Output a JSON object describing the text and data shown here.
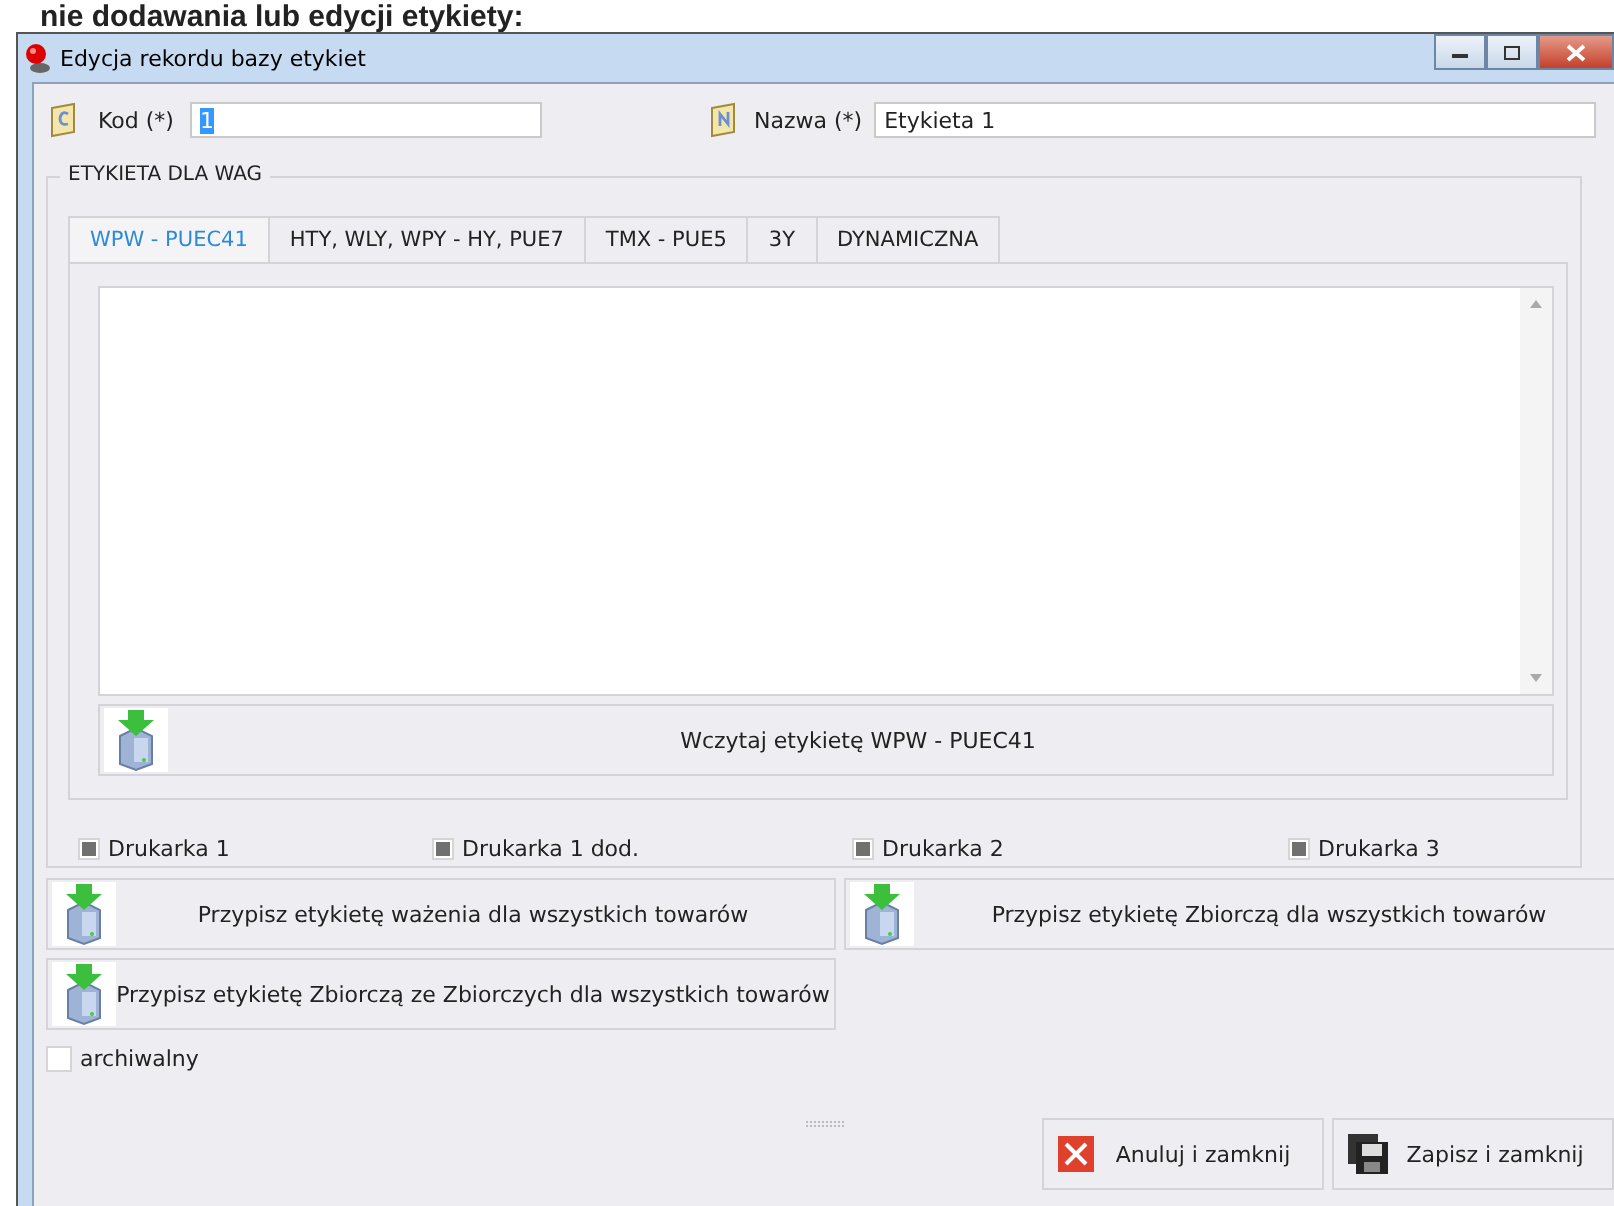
{
  "heading": "nie dodawania lub edycji etykiety:",
  "window": {
    "title": "Edycja rekordu bazy etykiet"
  },
  "fields": [
    {
      "kind": "code",
      "label": "Kod (*)",
      "value": "1"
    },
    {
      "kind": "name",
      "label": "Nazwa (*)",
      "value": "Etykieta 1"
    }
  ],
  "group": {
    "title": "ETYKIETA DLA WAG",
    "tabs": [
      {
        "label": "WPW - PUEC41",
        "selected": true
      },
      {
        "label": "HTY, WLY, WPY - HY, PUE7",
        "selected": false
      },
      {
        "label": "TMX - PUE5",
        "selected": false
      },
      {
        "label": "3Y",
        "selected": false
      },
      {
        "label": "DYNAMICZNA",
        "selected": false
      }
    ],
    "load_button": "Wczytaj etykietę WPW - PUEC41",
    "printers": [
      {
        "label": "Drukarka 1",
        "checked": true
      },
      {
        "label": "Drukarka 1  dod.",
        "checked": true
      },
      {
        "label": "Drukarka 2",
        "checked": true
      },
      {
        "label": "Drukarka 3",
        "checked": true
      }
    ]
  },
  "assign_buttons": [
    "Przypisz etykietę ważenia dla wszystkich towarów",
    "Przypisz etykietę Zbiorczą dla wszystkich towarów",
    "Przypisz etykietę Zbiorczą ze Zbiorczych dla wszystkich towarów"
  ],
  "archive": {
    "label": "archiwalny",
    "checked": false
  },
  "buttons": [
    {
      "kind": "cancel",
      "label": "Anuluj i zamknij"
    },
    {
      "kind": "save",
      "label": "Zapisz i zamknij"
    }
  ]
}
